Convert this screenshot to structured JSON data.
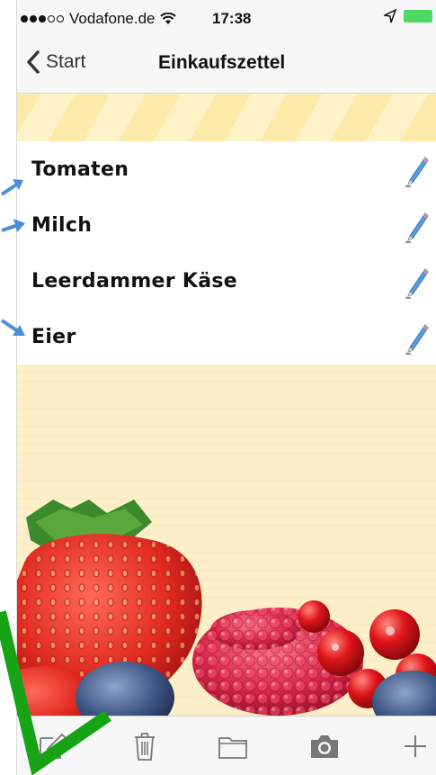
{
  "status_bar": {
    "carrier": "Vodafone.de",
    "time": "17:38"
  },
  "nav": {
    "back_label": "Start",
    "title": "Einkaufszettel"
  },
  "list": {
    "items": [
      {
        "label": "Tomaten"
      },
      {
        "label": "Milch"
      },
      {
        "label": "Leerdammer Käse"
      },
      {
        "label": "Eier"
      }
    ]
  },
  "colors": {
    "accent_blue": "#4a8fd6",
    "annotation_green": "#16a316",
    "paper": "#fdf0cc"
  },
  "toolbar": {
    "icons": [
      "compose-icon",
      "trash-icon",
      "folder-icon",
      "camera-icon",
      "plus-icon"
    ]
  }
}
